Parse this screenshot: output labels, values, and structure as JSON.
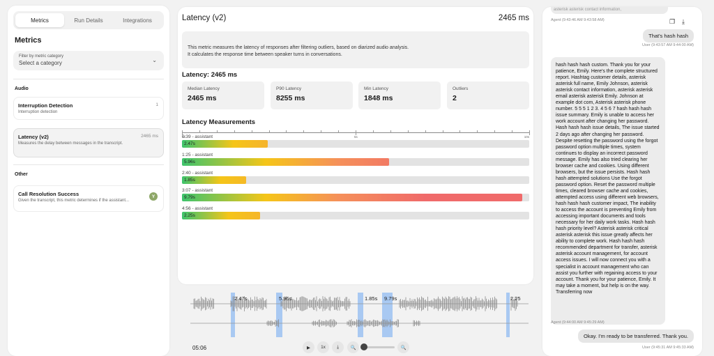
{
  "left": {
    "tabs": [
      "Metrics",
      "Run Details",
      "Integrations"
    ],
    "heading": "Metrics",
    "filter": {
      "label": "Filter by metric category",
      "placeholder": "Select a category"
    },
    "sections": [
      {
        "name": "Audio",
        "items": [
          {
            "title": "Interruption Detection",
            "desc": "Interruption detection",
            "right": "1"
          },
          {
            "title": "Latency (v2)",
            "desc": "Measures the delay between messages in the transcript.",
            "right": "2465 ms"
          }
        ]
      },
      {
        "name": "Other",
        "items": [
          {
            "title": "Call Resolution Success",
            "desc": "Given the transcript, this metric determines if the assistant...",
            "badge": "Y"
          }
        ]
      }
    ]
  },
  "center": {
    "title": "Latency (v2)",
    "value": "2465 ms",
    "desc1": "This metric measures the latency of responses after filtering outliers, based on diarized audio analysis.",
    "desc2": "It calculates the response time between speaker turns in conversations.",
    "latency_label": "Latency: 2465 ms",
    "stats": [
      {
        "label": "Median Latency",
        "value": "2465 ms"
      },
      {
        "label": "P90 Latency",
        "value": "8255 ms"
      },
      {
        "label": "Min Latency",
        "value": "1848 ms"
      },
      {
        "label": "Outliers",
        "value": "2"
      }
    ],
    "measurements_title": "Latency Measurements",
    "axis_labels": [
      "0s",
      "5s",
      "10s"
    ],
    "measurements": [
      {
        "label": "0:39 - assistant",
        "value": 2.47,
        "text": "2.47s"
      },
      {
        "label": "1:25 - assistant",
        "value": 5.96,
        "text": "5.96s"
      },
      {
        "label": "2:40 - assistant",
        "value": 1.85,
        "text": "1.85s"
      },
      {
        "label": "3:07 - assistant",
        "value": 9.79,
        "text": "9.79s"
      },
      {
        "label": "4:56 - assistant",
        "value": 2.25,
        "text": "2.25s"
      }
    ]
  },
  "player": {
    "time": "05:06",
    "markers": [
      "2.47s",
      "5.96s",
      "1.85s",
      "9.79s",
      "2.25"
    ],
    "controls": [
      "play-icon",
      "1x",
      "download-icon",
      "zoom-out-icon",
      "zoom-in-icon"
    ],
    "speed": "1x"
  },
  "transcript": {
    "top_fragment": "asterisk asterisk contact information,",
    "agent_meta_1": "Agent  (9:43:46 AM 9:43:58 AM)",
    "user_msg_1": "That's hash hash",
    "user_meta_1": "User  (9:43:57 AM 9:44:00 AM)",
    "agent_msg": "hash hash hash custom. Thank you for your patience, Emily. Here's the complete structured report. Hashtag customer details, asterisk asterisk full name, Emily Johnson, asterisk asterisk contact information, asterisk asterisk email asterisk asterisk Emily. Johnson at example dot com, Asterisk asterisk phone number. 5 5 5 1 2 3. 4 5 6 7 hash hash hash issue summary. Emily is unable to access her work account after changing her password. Hash hash hash issue details, The issue started 2 days ago after changing her password. Despite resetting the password using the forgot password option multiple times, system continues to display an incorrect password message. Emily has also tried clearing her browser cache and cookies. Using different browsers, but the issue persists. Hash hash hash attempted solutions Use the forgot password option. Reset the password multiple times, cleared browser cache and cookies, attempted access using different web browsers, hash hash hash customer impact, The inability to access the account is preventing Emily from accessing important documents and tools necessary for her daily work tasks. Hash hash hash priority level? Asterisk asterisk critical asterisk asterisk this issue greatly affects her ability to complete work. Hash hash hash recommended department for transfer, asterisk asterisk account management, for account access issues. I will now connect you with a specialist in account management who can assist you further with regaining access to your account. Thank you for your patience, Emily. It may take a moment, but help is on the way. Transferring now",
    "agent_meta_2": "Agent  (9:44:00 AM 9:45:29 AM)",
    "user_msg_2": "Okay. I'm ready to be transferred. Thank you.",
    "user_meta_2": "User  (9:45:31 AM 9:45:33 AM)"
  }
}
